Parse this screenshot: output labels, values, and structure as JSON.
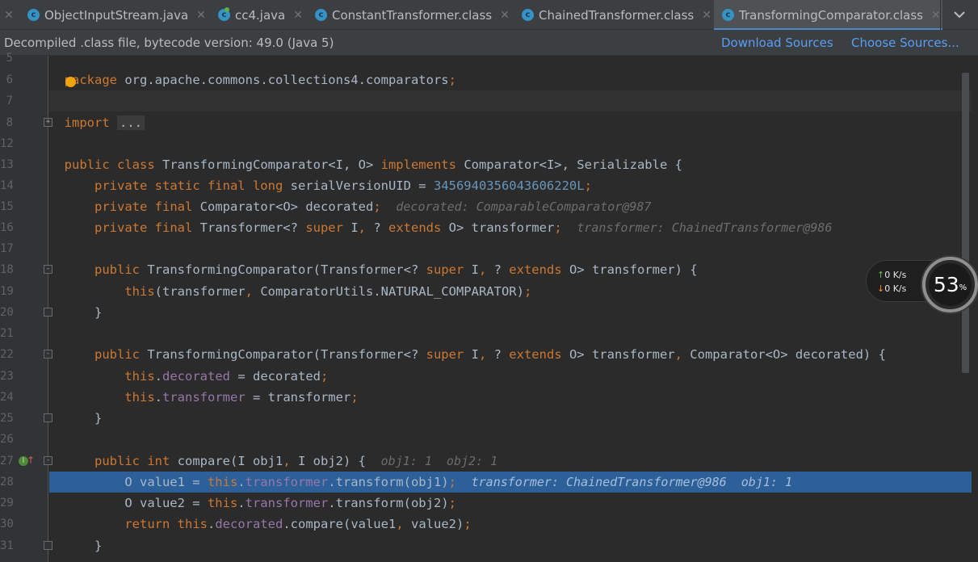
{
  "tabs": [
    {
      "label": "ObjectInputStream.java",
      "icon": "class-icon"
    },
    {
      "label": "cc4.java",
      "icon": "class-runnable-icon"
    },
    {
      "label": "ConstantTransformer.class",
      "icon": "class-icon"
    },
    {
      "label": "ChainedTransformer.class",
      "icon": "class-icon"
    },
    {
      "label": "TransformingComparator.class",
      "icon": "class-icon",
      "active": true
    }
  ],
  "banner": {
    "text": "Decompiled .class file, bytecode version: 49.0 (Java 5)",
    "download_sources": "Download Sources",
    "choose_sources": "Choose Sources..."
  },
  "network": {
    "up": "0",
    "down": "0",
    "unit": "K/s",
    "load": "53",
    "load_unit": "%"
  },
  "code": {
    "linenos": [
      "5",
      "6",
      "7",
      "8",
      "12",
      "13",
      "14",
      "15",
      "16",
      "17",
      "18",
      "19",
      "20",
      "21",
      "22",
      "23",
      "24",
      "25",
      "26",
      "27",
      "28",
      "29",
      "30",
      "31"
    ],
    "package_kw": "package",
    "package_name": "org.apache.commons.collections4.comparators",
    "import_kw": "import",
    "import_fold": "...",
    "class_decl": {
      "mods": "public class",
      "name": "TransformingComparator<I, O>",
      "impl": "implements",
      "ifaces": "Comparator<I>, Serializable {"
    },
    "serial": {
      "mods": "private static final long",
      "field": "serialVersionUID",
      "eq": " = ",
      "value": "3456940356043606220L"
    },
    "decorated_field": {
      "mods": "private final",
      "type": "Comparator<O>",
      "name": "decorated",
      "hint": "decorated: ComparableComparator@987"
    },
    "transformer_field": {
      "mods": "private final",
      "hint": "transformer: ChainedTransformer@986"
    },
    "ctor1_call": "ComparatorUtils.NATURAL_COMPARATOR",
    "compare_hint": "obj1: 1  obj2: 1",
    "exec_hint": "transformer: ChainedTransformer@986  obj1: 1"
  }
}
